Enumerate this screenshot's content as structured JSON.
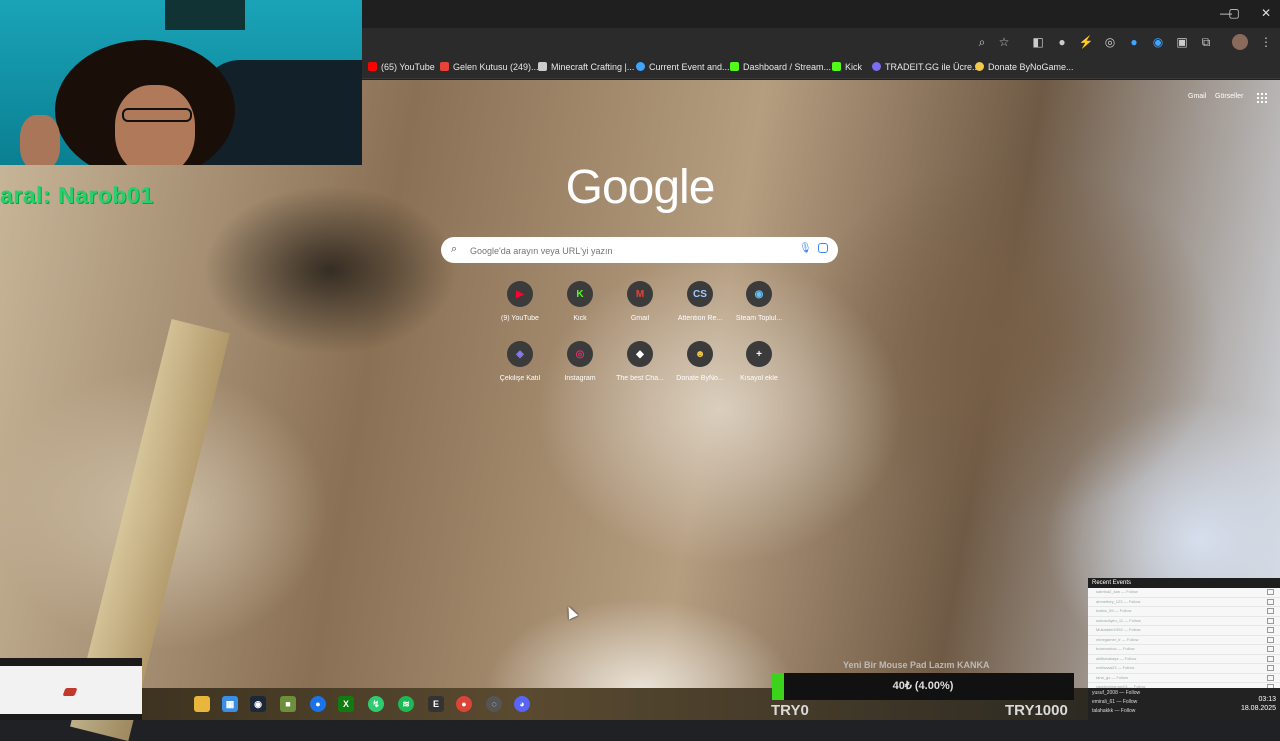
{
  "browser": {
    "window_controls": {
      "minimize": "—",
      "maximize": "▢",
      "close": "✕"
    },
    "bookmarks": [
      {
        "label": "(65) YouTube",
        "color": "#ff0000"
      },
      {
        "label": "Gelen Kutusu (249)...",
        "color": "#ea4335"
      },
      {
        "label": "Minecraft Crafting |...",
        "color": "#cccccc"
      },
      {
        "label": "Current Event and...",
        "color": "#3ea6ff"
      },
      {
        "label": "Dashboard / Stream...",
        "color": "#53fc18"
      },
      {
        "label": "Kick",
        "color": "#53fc18"
      },
      {
        "label": "TRADEIT.GG ile Ücre...",
        "color": "#7b6cf6"
      },
      {
        "label": "Donate ByNoGame...",
        "color": "#f2c94c"
      }
    ],
    "top_links": {
      "gmail": "Gmail",
      "images": "Görseller"
    }
  },
  "google": {
    "logo": "Google",
    "search_placeholder": "Google'da arayın veya URL'yi yazın",
    "shortcuts": [
      {
        "label": "(9) YouTube",
        "glyph": "▶",
        "color": "#ff0033"
      },
      {
        "label": "Kick",
        "glyph": "K",
        "color": "#53fc18"
      },
      {
        "label": "Gmail",
        "glyph": "M",
        "color": "#ea4335"
      },
      {
        "label": "Attention Re...",
        "glyph": "CS",
        "color": "#9ecbff"
      },
      {
        "label": "Steam Toplul...",
        "glyph": "◉",
        "color": "#66c0f4"
      },
      {
        "label": "Çekilişe Katıl",
        "glyph": "◈",
        "color": "#8b7cf6"
      },
      {
        "label": "Instagram",
        "glyph": "◎",
        "color": "#e1306c"
      },
      {
        "label": "The best Cha...",
        "glyph": "◆",
        "color": "#ffffff"
      },
      {
        "label": "Donate ByNo...",
        "glyph": "☻",
        "color": "#f2c94c"
      },
      {
        "label": "Kısayol ekle",
        "glyph": "+",
        "color": "#ffffff"
      }
    ]
  },
  "stream": {
    "overlay_text": "aral: Narob01",
    "goal_title": "Yeni Bir Mouse Pad Lazım KANKA",
    "goal_progress_text": "40₺ (4.00%)",
    "goal_fraction": 0.04,
    "goal_min": "TRY0",
    "goal_max": "TRY1000",
    "recent_events_title": "Recent Events",
    "events": [
      "sabrina2_kan — Follow",
      "ahmetbey_123 — Follow",
      "kratos_59 — Follow",
      "sokusoliyim_11 — Follow",
      "Mukadder1992 — Follow",
      "minegamer_tr — Follow",
      "busenurkoc — Follow",
      "akifkarakaya — Follow",
      "melisaaa23 — Follow",
      "taha_gs — Follow",
      "yagizkahraman04 — Follow",
      "sahiner_1967 — Follow"
    ],
    "tray_events": [
      "yusuf_2008 — Follow",
      "emirali_61 — Follow",
      "talahakkk — Follow"
    ],
    "clock_time": "03:13",
    "clock_date": "18.08.2025"
  }
}
